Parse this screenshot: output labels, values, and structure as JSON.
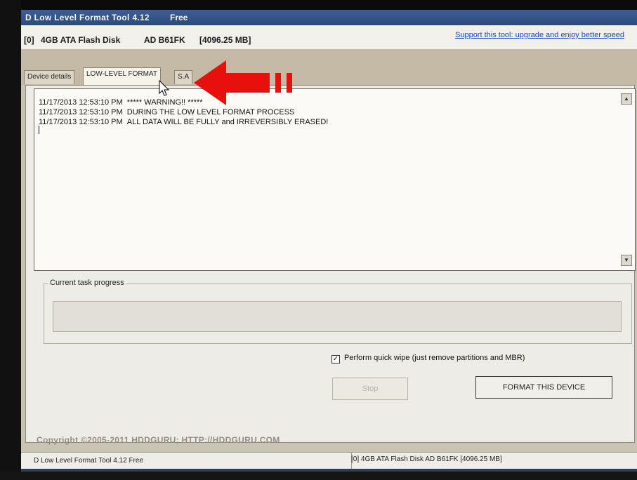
{
  "window": {
    "title": "D Low Level Format Tool 4.12",
    "edition": "Free"
  },
  "device_bar": {
    "index": "[0]",
    "device_name": "4GB ATA Flash Disk",
    "model": "AD B61FK",
    "capacity": "[4096.25 MB]",
    "support_link": "Support this tool: upgrade and enjoy better speed"
  },
  "tabs": [
    {
      "label": "Device details"
    },
    {
      "label": "LOW-LEVEL FORMAT"
    },
    {
      "label": "S.A"
    }
  ],
  "log": [
    {
      "timestamp": "11/17/2013 12:53:10 PM",
      "message": "***** WARNING!! *****"
    },
    {
      "timestamp": "11/17/2013 12:53:10 PM",
      "message": "DURING THE LOW LEVEL FORMAT PROCESS"
    },
    {
      "timestamp": "11/17/2013 12:53:10 PM",
      "message": "ALL DATA WILL BE FULLY and IRREVERSIBLY ERASED!"
    }
  ],
  "progress": {
    "label": "Current task progress",
    "value_fraction": 0
  },
  "options": {
    "quick_wipe_label": "Perform quick wipe (just remove partitions and MBR)",
    "quick_wipe_checked": true,
    "checkmark": "✓"
  },
  "buttons": {
    "stop_label": "Stop",
    "format_label": "FORMAT THIS DEVICE"
  },
  "footer": {
    "copyright": "Copyright ©2005-2011 HDDGURU;   HTTP://HDDGURU.COM"
  },
  "statusbar": {
    "left": "D Low Level Format Tool 4.12   Free",
    "right": "[0]  4GB ATA Flash Disk    AD B61FK   [4096.25 MB]"
  },
  "colors": {
    "arrow": "#e8100c",
    "accent_title": "#2c4a7c"
  },
  "icons": {
    "arrow": "red-arrow-icon",
    "cursor": "mouse-pointer-icon",
    "scroll_up": "scroll-up-arrow-icon",
    "scroll_down": "scroll-down-arrow-icon"
  }
}
